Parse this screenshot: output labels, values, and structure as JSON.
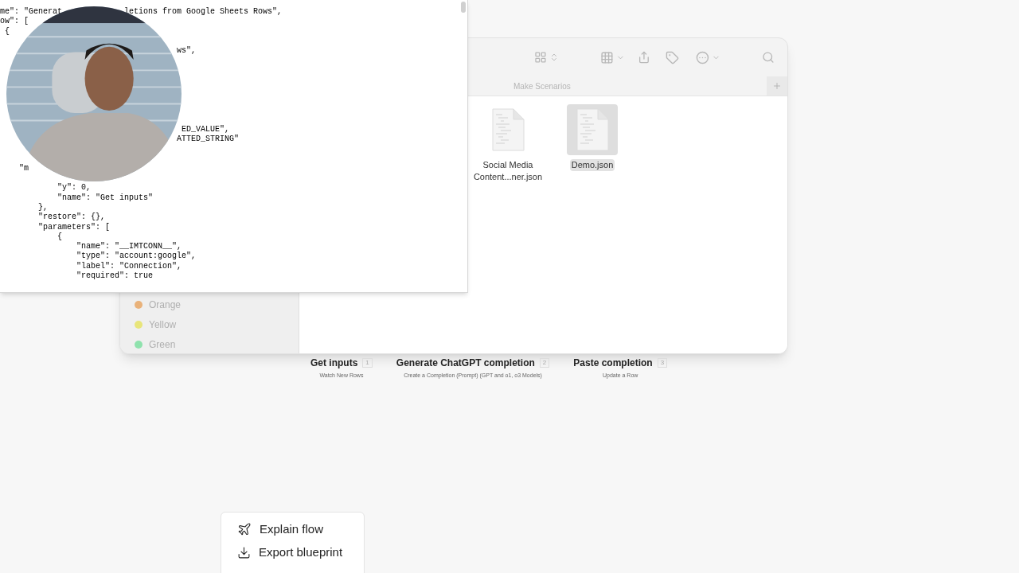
{
  "editor": {
    "lines": [
      {
        "segments": [
          "me\": \"Generat",
          "             letions from Google Sheets Rows\","
        ]
      },
      {
        "segments": [
          "ow\": ["
        ]
      },
      {
        "segments": [
          " {"
        ]
      },
      {
        "blank": true
      },
      {
        "segments": [
          "                                     ws\","
        ]
      },
      {
        "blank": true
      },
      {
        "blank": true
      },
      {
        "blank": true
      },
      {
        "blank": true
      },
      {
        "blank": true
      },
      {
        "blank": true
      },
      {
        "blank": true
      },
      {
        "segments": [
          "                                      ED_VALUE\","
        ]
      },
      {
        "segments": [
          "                                     ATTED_STRING\""
        ]
      },
      {
        "blank": true
      },
      {
        "blank": true
      },
      {
        "segments": [
          "    \"m"
        ]
      },
      {
        "blank": true
      },
      {
        "segments": [
          "            \"y\": 0,"
        ]
      },
      {
        "segments": [
          "            \"name\": \"Get inputs\""
        ]
      },
      {
        "segments": [
          "        },"
        ]
      },
      {
        "segments": [
          "        \"restore\": {},"
        ]
      },
      {
        "segments": [
          "        \"parameters\": ["
        ]
      },
      {
        "segments": [
          "            {"
        ]
      },
      {
        "segments": [
          "                \"name\": \"__IMTCONN__\","
        ]
      },
      {
        "segments": [
          "                \"type\": \"account:google\","
        ]
      },
      {
        "segments": [
          "                \"label\": \"Connection\","
        ]
      },
      {
        "segments": [
          "                \"required\": true"
        ]
      }
    ]
  },
  "finder": {
    "tab": {
      "label": "Make Scenarios"
    },
    "sidebar_tags": [
      {
        "label": "Orange",
        "color": "#e9b27a"
      },
      {
        "label": "Yellow",
        "color": "#e8e57a"
      },
      {
        "label": "Green",
        "color": "#8fe2ad"
      }
    ],
    "files": [
      {
        "name": "Social Media Content...ner.json",
        "selected": false
      },
      {
        "name": "Demo.json",
        "selected": true
      }
    ]
  },
  "modules": [
    {
      "title": "Get inputs",
      "number": "1",
      "subtitle": "Watch New Rows"
    },
    {
      "title": "Generate ChatGPT completion",
      "number": "2",
      "subtitle": "Create a Completion (Prompt) (GPT and o1, o3 Models)"
    },
    {
      "title": "Paste completion",
      "number": "3",
      "subtitle": "Update a Row"
    }
  ],
  "menu": {
    "items": [
      {
        "label": "Explain flow",
        "kind": "explain"
      },
      {
        "label": "Export blueprint",
        "kind": "export"
      }
    ]
  }
}
